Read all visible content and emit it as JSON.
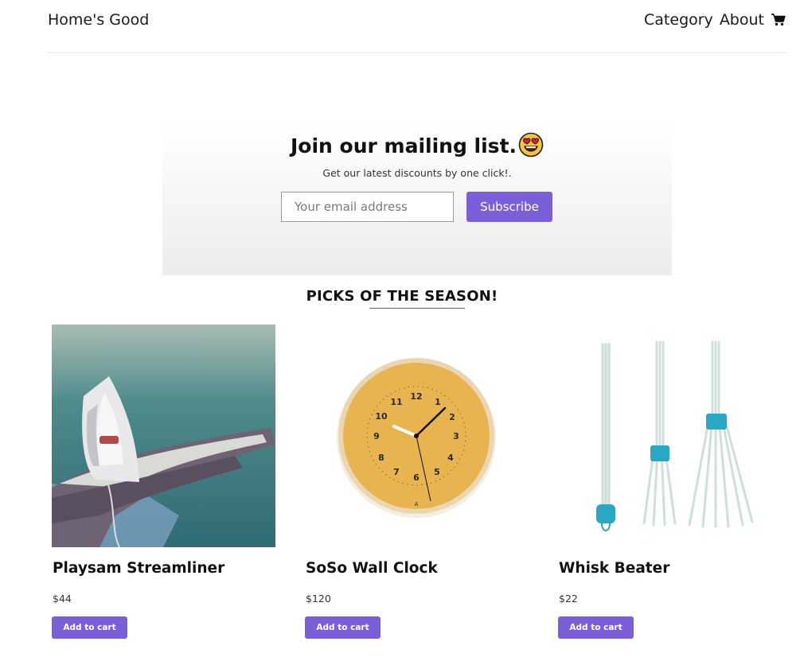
{
  "nav": {
    "brand": "Home's Good",
    "links": [
      "Category",
      "About"
    ],
    "cart_icon": "cart-icon"
  },
  "mailing": {
    "title": "Join our mailing list.",
    "emoji_icon": "heart-eyes-emoji-icon",
    "subtitle": "Get our latest discounts by one click!.",
    "email_placeholder": "Your email address",
    "subscribe_label": "Subscribe"
  },
  "picks": {
    "heading": "PICKS OF THE SEASON!",
    "products": [
      {
        "name": "Playsam Streamliner",
        "price": "$44",
        "button": "Add to cart",
        "image": "clothes-iron-image"
      },
      {
        "name": "SoSo Wall Clock",
        "price": "$120",
        "button": "Add to cart",
        "image": "wall-clock-image"
      },
      {
        "name": "Whisk Beater",
        "price": "$22",
        "button": "Add to cart",
        "image": "whisk-image"
      }
    ]
  },
  "colors": {
    "accent": "#7b5ed8",
    "clock_face": "#e8b44f"
  }
}
